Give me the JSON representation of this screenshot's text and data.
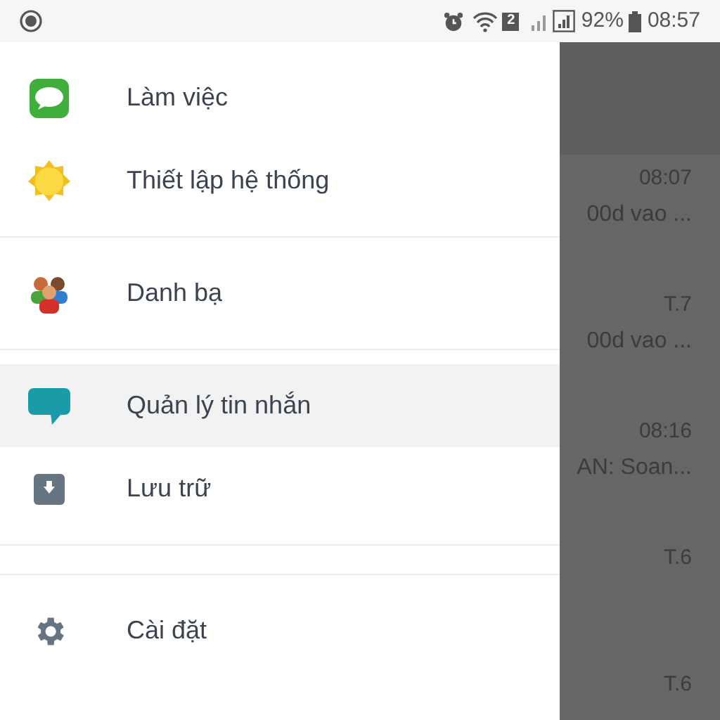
{
  "status_bar": {
    "sim": "2",
    "battery": "92%",
    "time": "08:57"
  },
  "drawer": {
    "groups": [
      {
        "kind": "menu",
        "items": [
          {
            "label": "Làm việc",
            "kind": "sms",
            "selected": false
          },
          {
            "label": "Thiết lập hệ thống",
            "kind": "sun",
            "selected": false
          }
        ]
      },
      {
        "kind": "menu",
        "items": [
          {
            "label": "Danh bạ",
            "kind": "people",
            "selected": false
          }
        ]
      },
      {
        "kind": "menu",
        "items": [
          {
            "label": "Quản lý tin nhắn",
            "kind": "bubble",
            "selected": true
          },
          {
            "label": "Lưu trữ",
            "kind": "archive",
            "selected": false
          }
        ]
      },
      {
        "kind": "spacer"
      },
      {
        "kind": "menu",
        "items": [
          {
            "label": "Cài đặt",
            "kind": "gear",
            "selected": false
          }
        ]
      }
    ]
  },
  "messages": [
    {
      "time": "08:07",
      "snippet": "00d vao ..."
    },
    {
      "time": "T.7",
      "snippet": "00d vao ..."
    },
    {
      "time": "08:16",
      "snippet": "AN: Soan..."
    },
    {
      "time": "T.6"
    },
    {
      "time": "T.6"
    }
  ]
}
